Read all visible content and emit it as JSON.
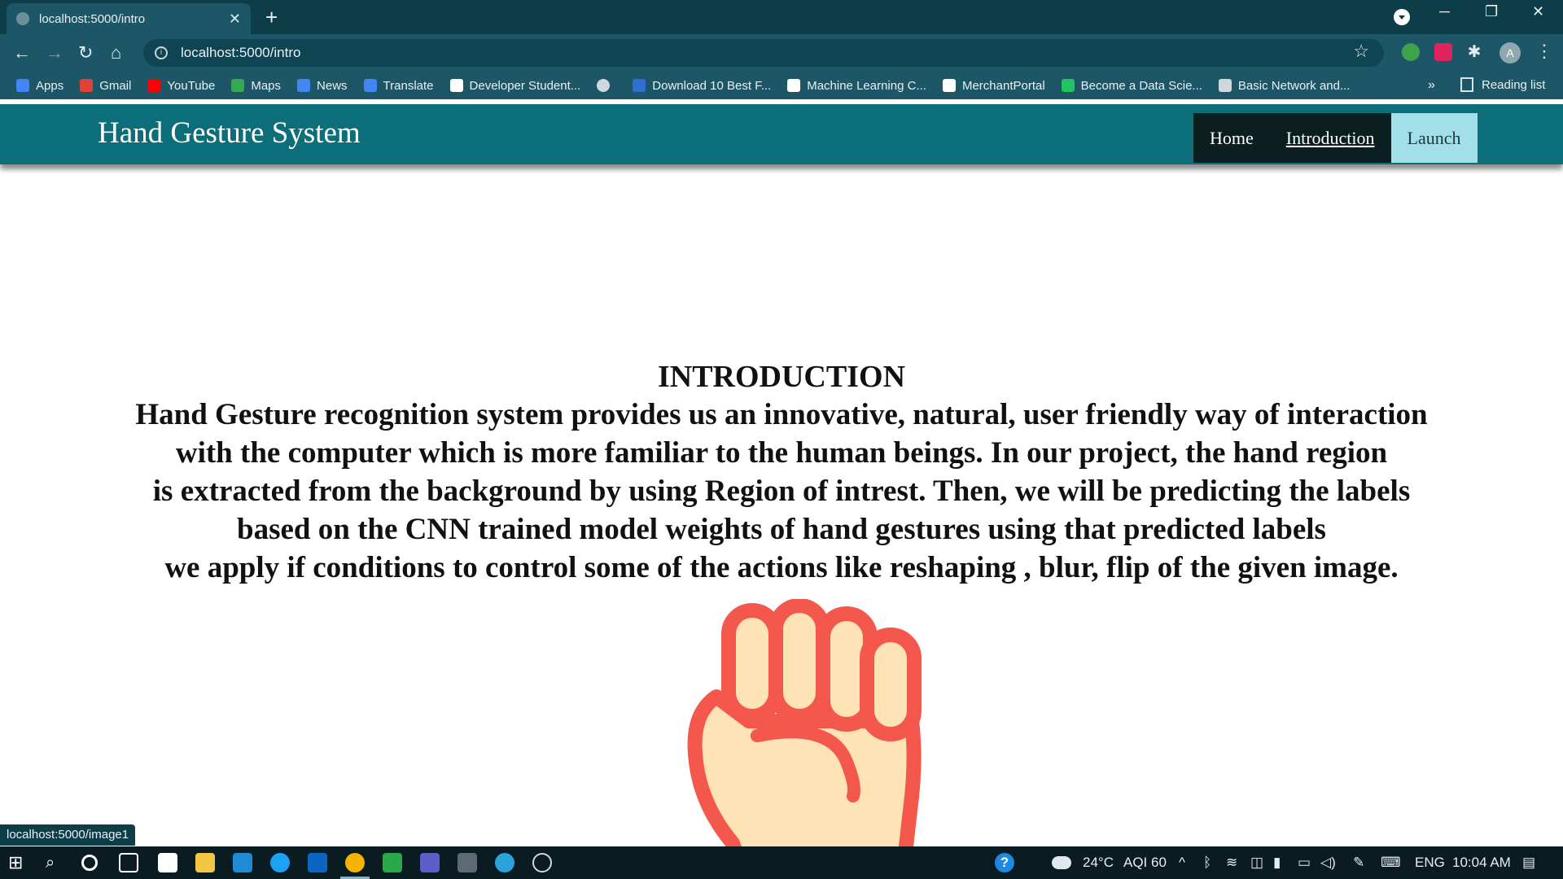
{
  "browser": {
    "tab_title": "localhost:5000/intro",
    "url": "localhost:5000/intro",
    "status_url": "localhost:5000/image1",
    "bookmarks": [
      {
        "label": "Apps",
        "color": "#e04a3b"
      },
      {
        "label": "Gmail",
        "color": "#e34133"
      },
      {
        "label": "YouTube",
        "color": "#ff0000"
      },
      {
        "label": "Maps",
        "color": "#34a853"
      },
      {
        "label": "News",
        "color": "#4285f4"
      },
      {
        "label": "Translate",
        "color": "#4285f4"
      },
      {
        "label": "Developer Student...",
        "color": "#ffffff"
      },
      {
        "label": "",
        "color": "#cfd8dc"
      },
      {
        "label": "Download 10 Best F...",
        "color": "#2f6fd1"
      },
      {
        "label": "Machine Learning C...",
        "color": "#ffffff"
      },
      {
        "label": "MerchantPortal",
        "color": "#ffffff"
      },
      {
        "label": "Become a Data Scie...",
        "color": "#21c55d"
      },
      {
        "label": "Basic Network and...",
        "color": "#cfd8dc"
      }
    ],
    "reading_list": "Reading list",
    "bookmark_overflow": "»"
  },
  "site": {
    "brand": "Hand Gesture System",
    "nav": [
      {
        "label": "Home"
      },
      {
        "label": "Introduction"
      },
      {
        "label": "Launch"
      }
    ]
  },
  "content": {
    "heading": "INTRODUCTION",
    "lines": [
      "Hand Gesture recognition system provides us an innovative, natural, user friendly way of interaction",
      "with the computer which is more familiar to the human beings. In our project, the hand region",
      "is extracted from the background by using Region of intrest. Then, we will be predicting the labels",
      "based on the CNN trained model weights of hand gestures using that predicted labels",
      "we apply if conditions to control some of the actions like reshaping , blur, flip of the given image."
    ]
  },
  "taskbar": {
    "weather": "24°C",
    "aqi": "AQI 60",
    "language": "ENG",
    "time": "10:04 AM"
  },
  "colors": {
    "header_bg": "#0b6e78",
    "nav_bg": "#0b1f21",
    "nav_hover": "#a3dfe8",
    "fist_outline": "#f4574b",
    "fist_fill": "#fde3b5"
  }
}
